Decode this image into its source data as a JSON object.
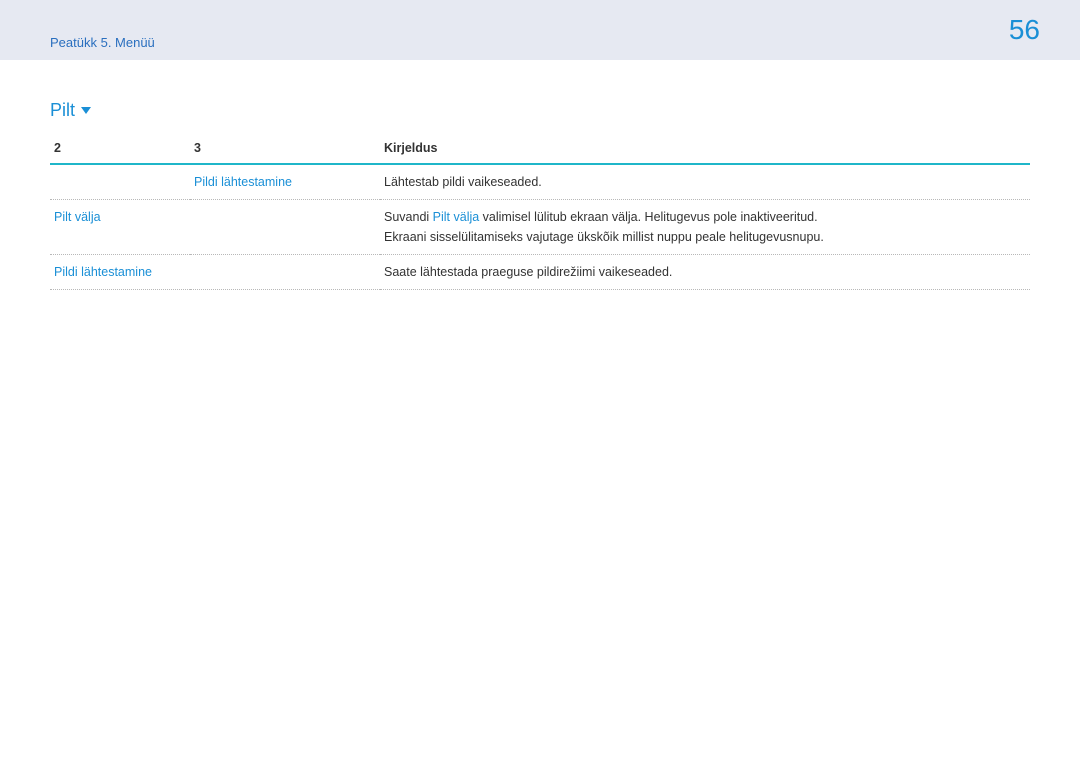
{
  "header": {
    "breadcrumb": "Peatükk 5. Menüü",
    "page_number": "56"
  },
  "section": {
    "title": "Pilt"
  },
  "table": {
    "headers": {
      "col2": "2",
      "col3": "3",
      "desc": "Kirjeldus"
    },
    "rows": {
      "r1": {
        "col2": "",
        "col3": "Pildi lähtestamine",
        "desc": "Lähtestab pildi vaikeseaded."
      },
      "r2": {
        "col2": "Pilt välja",
        "col3": "",
        "desc_prefix": "Suvandi ",
        "desc_highlight": "Pilt välja",
        "desc_mid": " valimisel lülitub ekraan välja. Helitugevus pole inaktiveeritud.",
        "desc_line2": "Ekraani sisselülitamiseks vajutage ükskõik millist nuppu peale helitugevusnupu."
      },
      "r3": {
        "col2": "Pildi lähtestamine",
        "col3": "",
        "desc": "Saate lähtestada praeguse pildirežiimi vaikeseaded."
      }
    }
  }
}
